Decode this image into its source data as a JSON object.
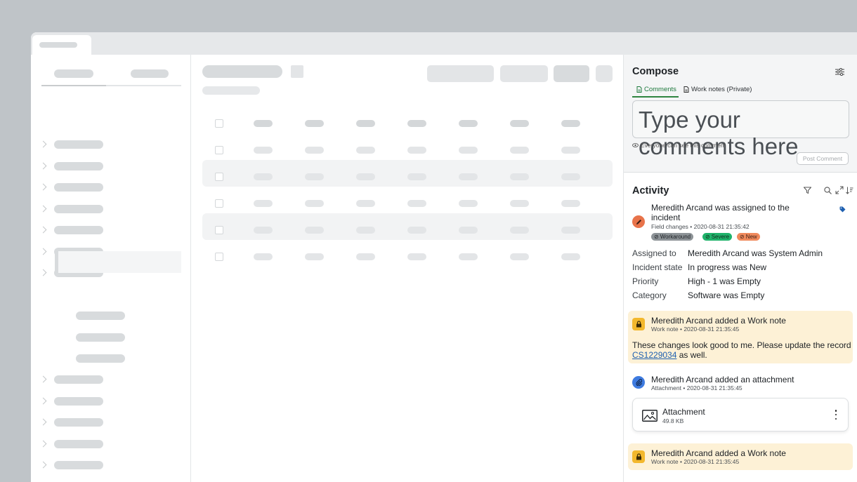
{
  "compose": {
    "title": "Compose",
    "tabs": [
      {
        "label": "Comments",
        "active": true
      },
      {
        "label": "Work notes (Private)",
        "active": false
      }
    ],
    "placeholder": "Type your comments here",
    "visibility_note": "Everyone can see this comment",
    "post_button": "Post Comment"
  },
  "activity": {
    "title": "Activity",
    "entries": [
      {
        "title": "Meredith Arcand was assigned to the incident",
        "type": "Field changes",
        "timestamp": "2020-08-31 21:35:42",
        "badges": [
          "Workaround",
          "Severe",
          "New"
        ],
        "fields": [
          {
            "key": "Assigned to",
            "value": "Meredith Arcand was System Admin"
          },
          {
            "key": "Incident state",
            "value": "In progress was New"
          },
          {
            "key": "Priority",
            "value": "High - 1 was Empty"
          },
          {
            "key": "Category",
            "value": "Software was Empty"
          }
        ]
      },
      {
        "title": "Meredith Arcand added a Work note",
        "type": "Work note",
        "timestamp": "2020-08-31 21:35:45",
        "body_text": "These changes look good to me. Please update the record",
        "body_link": "CS1229034",
        "body_suffix": " as well."
      },
      {
        "title": "Meredith Arcand added an attachment",
        "type": "Attachment",
        "timestamp": "2020-08-31 21:35:45",
        "attachment_name": "Attachment",
        "attachment_size": "49.8 KB"
      },
      {
        "title": "Meredith Arcand added a Work note",
        "type": "Work note",
        "timestamp": "2020-08-31 21:35:45"
      }
    ]
  },
  "colors": {
    "field_change_avatar": "#e8734a",
    "work_note_avatar": "#f3b82d",
    "attachment_avatar": "#3e7be0",
    "badge_workaround": "#8d9397",
    "badge_severe": "#1fb36b",
    "badge_new": "#f08a5d",
    "work_note_bg": "#fdf1d6"
  }
}
